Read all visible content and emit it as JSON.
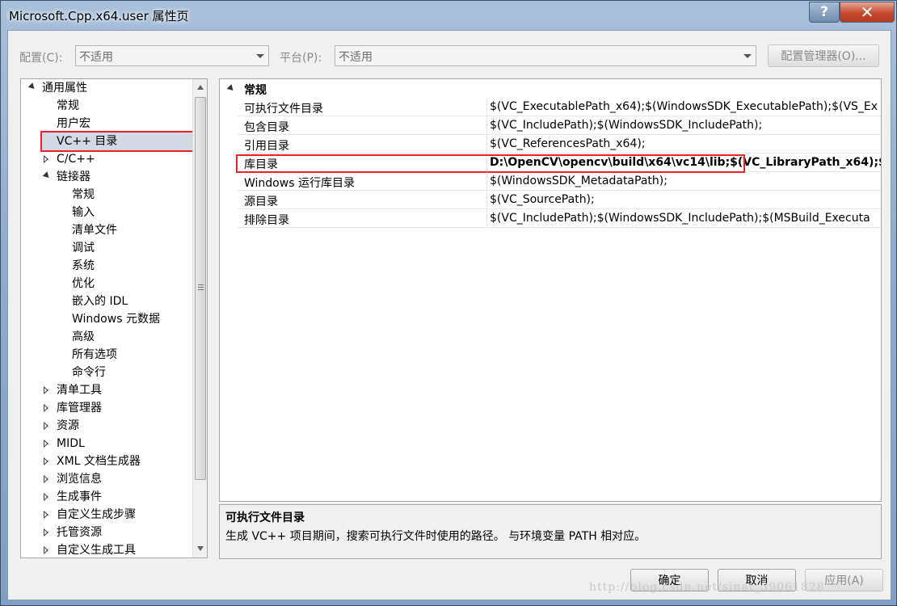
{
  "window": {
    "title": "Microsoft.Cpp.x64.user 属性页",
    "help_label": "?",
    "close_label": "✕"
  },
  "toolbar": {
    "config_label": "配置(C):",
    "config_value": "不适用",
    "platform_label": "平台(P):",
    "platform_value": "不适用",
    "config_manager_label": "配置管理器(O)..."
  },
  "tree": {
    "items": [
      {
        "label": "通用属性"
      },
      {
        "label": "常规"
      },
      {
        "label": "用户宏"
      },
      {
        "label": "VC++ 目录"
      },
      {
        "label": "C/C++"
      },
      {
        "label": "链接器"
      },
      {
        "label": "常规"
      },
      {
        "label": "输入"
      },
      {
        "label": "清单文件"
      },
      {
        "label": "调试"
      },
      {
        "label": "系统"
      },
      {
        "label": "优化"
      },
      {
        "label": "嵌入的 IDL"
      },
      {
        "label": "Windows 元数据"
      },
      {
        "label": "高级"
      },
      {
        "label": "所有选项"
      },
      {
        "label": "命令行"
      },
      {
        "label": "清单工具"
      },
      {
        "label": "库管理器"
      },
      {
        "label": "资源"
      },
      {
        "label": "MIDL"
      },
      {
        "label": "XML 文档生成器"
      },
      {
        "label": "浏览信息"
      },
      {
        "label": "生成事件"
      },
      {
        "label": "自定义生成步骤"
      },
      {
        "label": "托管资源"
      },
      {
        "label": "自定义生成工具"
      }
    ]
  },
  "grid": {
    "category": "常规",
    "rows": [
      {
        "name": "可执行文件目录",
        "value": "$(VC_ExecutablePath_x64);$(WindowsSDK_ExecutablePath);$(VS_Ex"
      },
      {
        "name": "包含目录",
        "value": "$(VC_IncludePath);$(WindowsSDK_IncludePath);"
      },
      {
        "name": "引用目录",
        "value": "$(VC_ReferencesPath_x64);"
      },
      {
        "name": "库目录",
        "value": "D:\\OpenCV\\opencv\\build\\x64\\vc14\\lib;$(VC_LibraryPath_x64);$("
      },
      {
        "name": "Windows 运行库目录",
        "value": "$(WindowsSDK_MetadataPath);"
      },
      {
        "name": "源目录",
        "value": "$(VC_SourcePath);"
      },
      {
        "name": "排除目录",
        "value": "$(VC_IncludePath);$(WindowsSDK_IncludePath);$(MSBuild_Executa"
      }
    ]
  },
  "description": {
    "title": "可执行文件目录",
    "text": "生成 VC++ 项目期间，搜索可执行文件时使用的路径。 与环境变量 PATH 相对应。"
  },
  "buttons": {
    "ok": "确定",
    "cancel": "取消",
    "apply": "应用(A)"
  },
  "watermark": "http://blog.csdn.net/sinat_39061828",
  "colors": {
    "highlight_box": "#e8242a",
    "selection": "#d3d9e4"
  }
}
